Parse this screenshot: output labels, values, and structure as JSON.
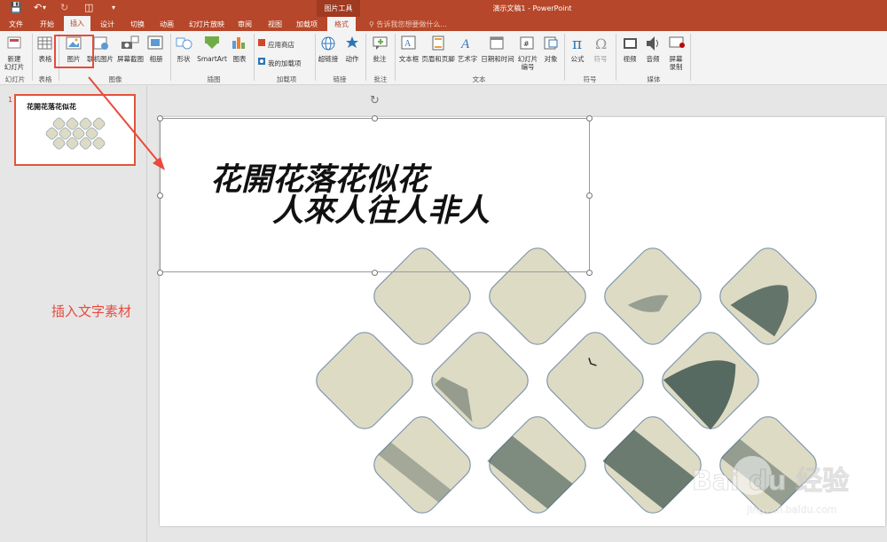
{
  "window": {
    "title": "演示文稿1 - PowerPoint",
    "context_group": "图片工具"
  },
  "tabs": [
    {
      "label": "文件"
    },
    {
      "label": "开始"
    },
    {
      "label": "插入",
      "active": true
    },
    {
      "label": "设计"
    },
    {
      "label": "切换"
    },
    {
      "label": "动画"
    },
    {
      "label": "幻灯片放映"
    },
    {
      "label": "审阅"
    },
    {
      "label": "视图"
    },
    {
      "label": "加载项"
    },
    {
      "label": "格式"
    }
  ],
  "tellme": "告诉我您想要做什么...",
  "ribbon": {
    "buttons": {
      "new_slide": "新建\n幻灯片",
      "table": "表格",
      "pictures": "图片",
      "online_pictures": "联机图片",
      "screenshot": "屏幕截图",
      "album": "相册",
      "shapes": "形状",
      "smartart": "SmartArt",
      "chart": "图表",
      "store": "应用商店",
      "my_addins": "我的加载项",
      "hyperlink": "超链接",
      "action": "动作",
      "comment": "批注",
      "textbox": "文本框",
      "header_footer": "页眉和页脚",
      "wordart": "艺术字",
      "date_time": "日期和时间",
      "slide_number": "幻灯片\n编号",
      "object": "对象",
      "equation": "公式",
      "symbol": "符号",
      "video": "视频",
      "audio": "音频",
      "screen_recording": "屏幕\n录制"
    },
    "groups": {
      "slides": "幻灯片",
      "tables": "表格",
      "images": "图像",
      "illustrations": "插图",
      "addins": "加载项",
      "links": "链接",
      "comments": "批注",
      "text": "文本",
      "symbols": "符号",
      "media": "媒体"
    }
  },
  "thumbnail": {
    "number": "1"
  },
  "slide": {
    "calligraphy_line1": "花開花落花似花",
    "calligraphy_line2": "人來人往人非人"
  },
  "annotation": {
    "callout": "插入文字素材"
  },
  "watermark": {
    "brand": "Bai du 经验",
    "site": "jingyan.baidu.com"
  },
  "colors": {
    "accent": "#b7472a",
    "highlight": "#e84a3c",
    "tile": "#dedbc4",
    "tile_border": "#7f97ad"
  }
}
